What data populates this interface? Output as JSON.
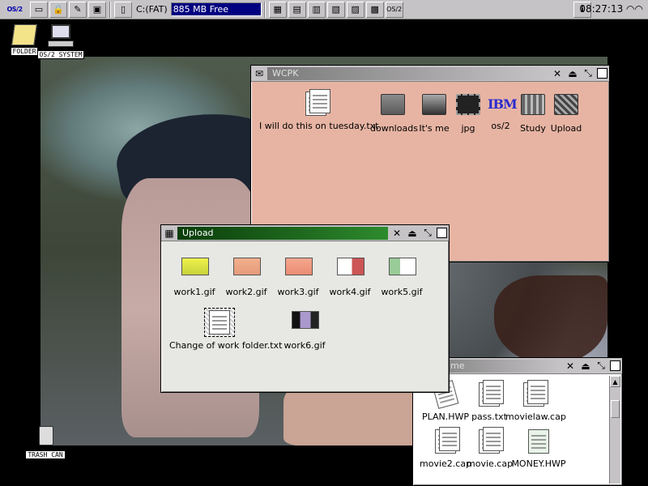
{
  "taskbar": {
    "os2_logo": "OS/2",
    "drive_label": "C:(FAT)",
    "drive_free": "885 MB Free",
    "os2_button": "OS/2",
    "clock": "08:27:13"
  },
  "desktop": {
    "icons": [
      {
        "label": "FOLDER"
      },
      {
        "label": "OS/2 SYSTEM"
      },
      {
        "label": "TRASH CAN"
      }
    ]
  },
  "windows": {
    "wcpk": {
      "title": "WCPK",
      "items": [
        {
          "name": "I will do this on tuesday.txt"
        },
        {
          "name": "downloads"
        },
        {
          "name": "It's me"
        },
        {
          "name": "jpg"
        },
        {
          "name": "os/2"
        },
        {
          "name": "Study"
        },
        {
          "name": "Upload"
        }
      ],
      "bg_color": "#e7b4a3"
    },
    "upload": {
      "title": "Upload",
      "items": [
        {
          "name": "work1.gif"
        },
        {
          "name": "work2.gif"
        },
        {
          "name": "work3.gif"
        },
        {
          "name": "work4.gif"
        },
        {
          "name": "work5.gif"
        },
        {
          "name": "Change of work folder.txt"
        },
        {
          "name": "work6.gif"
        }
      ],
      "bg_color": "#e7e7e3"
    },
    "third": {
      "title": "me",
      "items": [
        {
          "name": "PLAN.HWP"
        },
        {
          "name": "pass.txt"
        },
        {
          "name": "movielaw.cap"
        },
        {
          "name": "movie2.cap"
        },
        {
          "name": "movie.cap"
        },
        {
          "name": "MONEY.HWP"
        }
      ],
      "bg_color": "#ffffff"
    }
  },
  "colors": {
    "active_title": "#1f6a1f",
    "selection": "#000080"
  }
}
